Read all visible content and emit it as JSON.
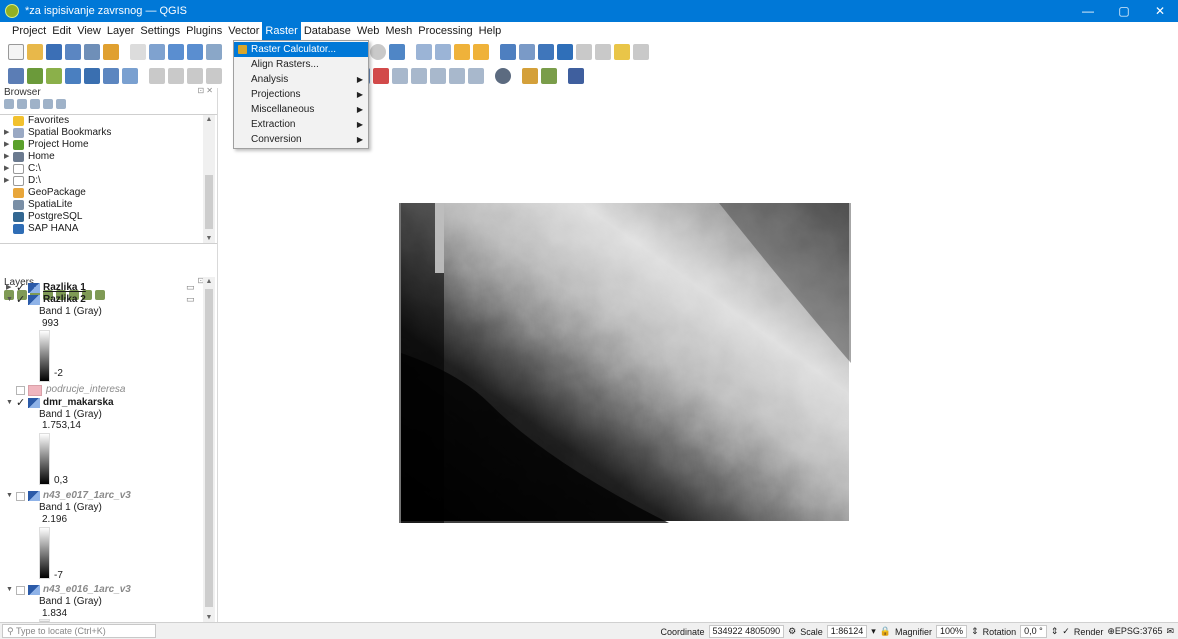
{
  "window": {
    "title": "*za ispisivanje zavrsnog — QGIS",
    "minimize": "—",
    "maximize": "▢",
    "close": "✕"
  },
  "menubar": [
    "Project",
    "Edit",
    "View",
    "Layer",
    "Settings",
    "Plugins",
    "Vector",
    "Raster",
    "Database",
    "Web",
    "Mesh",
    "Processing",
    "Help"
  ],
  "raster_menu": {
    "items": [
      {
        "label": "Raster Calculator...",
        "highlighted": true,
        "submenu": false
      },
      {
        "label": "Align Rasters...",
        "highlighted": false,
        "submenu": false
      },
      {
        "label": "Analysis",
        "highlighted": false,
        "submenu": true
      },
      {
        "label": "Projections",
        "highlighted": false,
        "submenu": true
      },
      {
        "label": "Miscellaneous",
        "highlighted": false,
        "submenu": true
      },
      {
        "label": "Extraction",
        "highlighted": false,
        "submenu": true
      },
      {
        "label": "Conversion",
        "highlighted": false,
        "submenu": true
      }
    ]
  },
  "browser": {
    "title": "Browser",
    "items": [
      {
        "label": "Favorites",
        "icon": "star-icon",
        "color": "#f2c12e",
        "expand": ""
      },
      {
        "label": "Spatial Bookmarks",
        "icon": "bookmark-icon",
        "color": "#9aa9c4",
        "expand": "▶"
      },
      {
        "label": "Project Home",
        "icon": "project-home-icon",
        "color": "#5aa02c",
        "expand": "▶"
      },
      {
        "label": "Home",
        "icon": "home-icon",
        "color": "#6b7a8f",
        "expand": "▶"
      },
      {
        "label": "C:\\",
        "icon": "drive-icon",
        "color": "#bfbfbf",
        "expand": "▶"
      },
      {
        "label": "D:\\",
        "icon": "drive-icon",
        "color": "#bfbfbf",
        "expand": "▶"
      },
      {
        "label": "GeoPackage",
        "icon": "geopackage-icon",
        "color": "#e8a63a",
        "expand": ""
      },
      {
        "label": "SpatiaLite",
        "icon": "spatialite-icon",
        "color": "#7a8fa6",
        "expand": ""
      },
      {
        "label": "PostgreSQL",
        "icon": "postgresql-icon",
        "color": "#336791",
        "expand": ""
      },
      {
        "label": "SAP HANA",
        "icon": "sap-hana-icon",
        "color": "#2f6db5",
        "expand": ""
      }
    ]
  },
  "layers": {
    "title": "Layers",
    "band_label": "Band 1 (Gray)",
    "items": [
      {
        "name": "Razlika 1",
        "checked": true,
        "expanded": false
      },
      {
        "name": "Razlika 2",
        "checked": true,
        "expanded": true,
        "max": "993",
        "min": "-2"
      },
      {
        "name": "podrucje_interesa",
        "checked": false,
        "expanded": false
      },
      {
        "name": "dmr_makarska",
        "checked": true,
        "expanded": true,
        "max": "1.753,14",
        "min": "0,3"
      },
      {
        "name": "n43_e017_1arc_v3",
        "checked": false,
        "expanded": true,
        "max": "2.196",
        "min": "-7"
      },
      {
        "name": "n43_e016_1arc_v3",
        "checked": false,
        "expanded": true,
        "max": "1.834"
      }
    ]
  },
  "statusbar": {
    "locator_placeholder": "Type to locate (Ctrl+K)",
    "coordinate_label": "Coordinate",
    "coordinate_value": "534922 4805090",
    "scale_label": "Scale",
    "scale_value": "1:86124",
    "magnifier_label": "Magnifier",
    "magnifier_value": "100%",
    "rotation_label": "Rotation",
    "rotation_value": "0,0 °",
    "render_label": "Render",
    "crs": "EPSG:3765"
  },
  "checkmark": "✓",
  "expand_open": "▼",
  "expand_closed": "▶"
}
